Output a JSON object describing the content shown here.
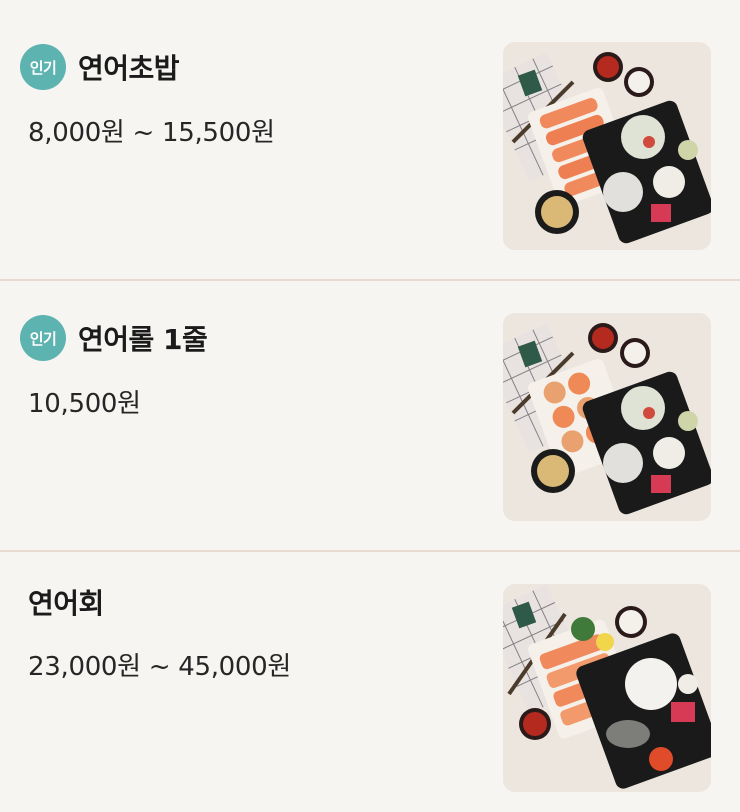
{
  "menu": {
    "items": [
      {
        "badge": "인기",
        "name": "연어초밥",
        "price": "8,000원 ~ 15,500원",
        "photo_icon": "salmon-sushi-box-photo"
      },
      {
        "badge": "인기",
        "name": "연어롤 1줄",
        "price": "10,500원",
        "photo_icon": "salmon-roll-box-photo"
      },
      {
        "badge": "",
        "name": "연어회",
        "price": "23,000원 ~ 45,000원",
        "photo_icon": "salmon-sashimi-box-photo"
      }
    ]
  },
  "colors": {
    "badge_bg": "#5cb3b0",
    "divider": "#ead9cf",
    "background": "#f6f5f2",
    "salmon": "#f08a5d"
  }
}
